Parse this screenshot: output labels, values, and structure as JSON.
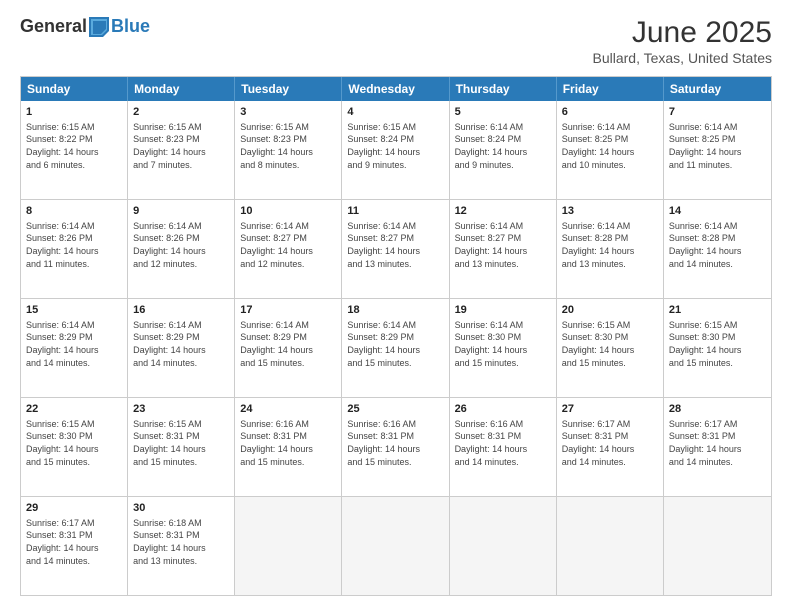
{
  "header": {
    "logo_general": "General",
    "logo_blue": "Blue",
    "month_title": "June 2025",
    "subtitle": "Bullard, Texas, United States"
  },
  "calendar": {
    "days_of_week": [
      "Sunday",
      "Monday",
      "Tuesday",
      "Wednesday",
      "Thursday",
      "Friday",
      "Saturday"
    ],
    "rows": [
      [
        {
          "day": "1",
          "info": "Sunrise: 6:15 AM\nSunset: 8:22 PM\nDaylight: 14 hours\nand 6 minutes."
        },
        {
          "day": "2",
          "info": "Sunrise: 6:15 AM\nSunset: 8:23 PM\nDaylight: 14 hours\nand 7 minutes."
        },
        {
          "day": "3",
          "info": "Sunrise: 6:15 AM\nSunset: 8:23 PM\nDaylight: 14 hours\nand 8 minutes."
        },
        {
          "day": "4",
          "info": "Sunrise: 6:15 AM\nSunset: 8:24 PM\nDaylight: 14 hours\nand 9 minutes."
        },
        {
          "day": "5",
          "info": "Sunrise: 6:14 AM\nSunset: 8:24 PM\nDaylight: 14 hours\nand 9 minutes."
        },
        {
          "day": "6",
          "info": "Sunrise: 6:14 AM\nSunset: 8:25 PM\nDaylight: 14 hours\nand 10 minutes."
        },
        {
          "day": "7",
          "info": "Sunrise: 6:14 AM\nSunset: 8:25 PM\nDaylight: 14 hours\nand 11 minutes."
        }
      ],
      [
        {
          "day": "8",
          "info": "Sunrise: 6:14 AM\nSunset: 8:26 PM\nDaylight: 14 hours\nand 11 minutes."
        },
        {
          "day": "9",
          "info": "Sunrise: 6:14 AM\nSunset: 8:26 PM\nDaylight: 14 hours\nand 12 minutes."
        },
        {
          "day": "10",
          "info": "Sunrise: 6:14 AM\nSunset: 8:27 PM\nDaylight: 14 hours\nand 12 minutes."
        },
        {
          "day": "11",
          "info": "Sunrise: 6:14 AM\nSunset: 8:27 PM\nDaylight: 14 hours\nand 13 minutes."
        },
        {
          "day": "12",
          "info": "Sunrise: 6:14 AM\nSunset: 8:27 PM\nDaylight: 14 hours\nand 13 minutes."
        },
        {
          "day": "13",
          "info": "Sunrise: 6:14 AM\nSunset: 8:28 PM\nDaylight: 14 hours\nand 13 minutes."
        },
        {
          "day": "14",
          "info": "Sunrise: 6:14 AM\nSunset: 8:28 PM\nDaylight: 14 hours\nand 14 minutes."
        }
      ],
      [
        {
          "day": "15",
          "info": "Sunrise: 6:14 AM\nSunset: 8:29 PM\nDaylight: 14 hours\nand 14 minutes."
        },
        {
          "day": "16",
          "info": "Sunrise: 6:14 AM\nSunset: 8:29 PM\nDaylight: 14 hours\nand 14 minutes."
        },
        {
          "day": "17",
          "info": "Sunrise: 6:14 AM\nSunset: 8:29 PM\nDaylight: 14 hours\nand 15 minutes."
        },
        {
          "day": "18",
          "info": "Sunrise: 6:14 AM\nSunset: 8:29 PM\nDaylight: 14 hours\nand 15 minutes."
        },
        {
          "day": "19",
          "info": "Sunrise: 6:14 AM\nSunset: 8:30 PM\nDaylight: 14 hours\nand 15 minutes."
        },
        {
          "day": "20",
          "info": "Sunrise: 6:15 AM\nSunset: 8:30 PM\nDaylight: 14 hours\nand 15 minutes."
        },
        {
          "day": "21",
          "info": "Sunrise: 6:15 AM\nSunset: 8:30 PM\nDaylight: 14 hours\nand 15 minutes."
        }
      ],
      [
        {
          "day": "22",
          "info": "Sunrise: 6:15 AM\nSunset: 8:30 PM\nDaylight: 14 hours\nand 15 minutes."
        },
        {
          "day": "23",
          "info": "Sunrise: 6:15 AM\nSunset: 8:31 PM\nDaylight: 14 hours\nand 15 minutes."
        },
        {
          "day": "24",
          "info": "Sunrise: 6:16 AM\nSunset: 8:31 PM\nDaylight: 14 hours\nand 15 minutes."
        },
        {
          "day": "25",
          "info": "Sunrise: 6:16 AM\nSunset: 8:31 PM\nDaylight: 14 hours\nand 15 minutes."
        },
        {
          "day": "26",
          "info": "Sunrise: 6:16 AM\nSunset: 8:31 PM\nDaylight: 14 hours\nand 14 minutes."
        },
        {
          "day": "27",
          "info": "Sunrise: 6:17 AM\nSunset: 8:31 PM\nDaylight: 14 hours\nand 14 minutes."
        },
        {
          "day": "28",
          "info": "Sunrise: 6:17 AM\nSunset: 8:31 PM\nDaylight: 14 hours\nand 14 minutes."
        }
      ],
      [
        {
          "day": "29",
          "info": "Sunrise: 6:17 AM\nSunset: 8:31 PM\nDaylight: 14 hours\nand 14 minutes."
        },
        {
          "day": "30",
          "info": "Sunrise: 6:18 AM\nSunset: 8:31 PM\nDaylight: 14 hours\nand 13 minutes."
        },
        {
          "day": "",
          "info": ""
        },
        {
          "day": "",
          "info": ""
        },
        {
          "day": "",
          "info": ""
        },
        {
          "day": "",
          "info": ""
        },
        {
          "day": "",
          "info": ""
        }
      ]
    ]
  }
}
